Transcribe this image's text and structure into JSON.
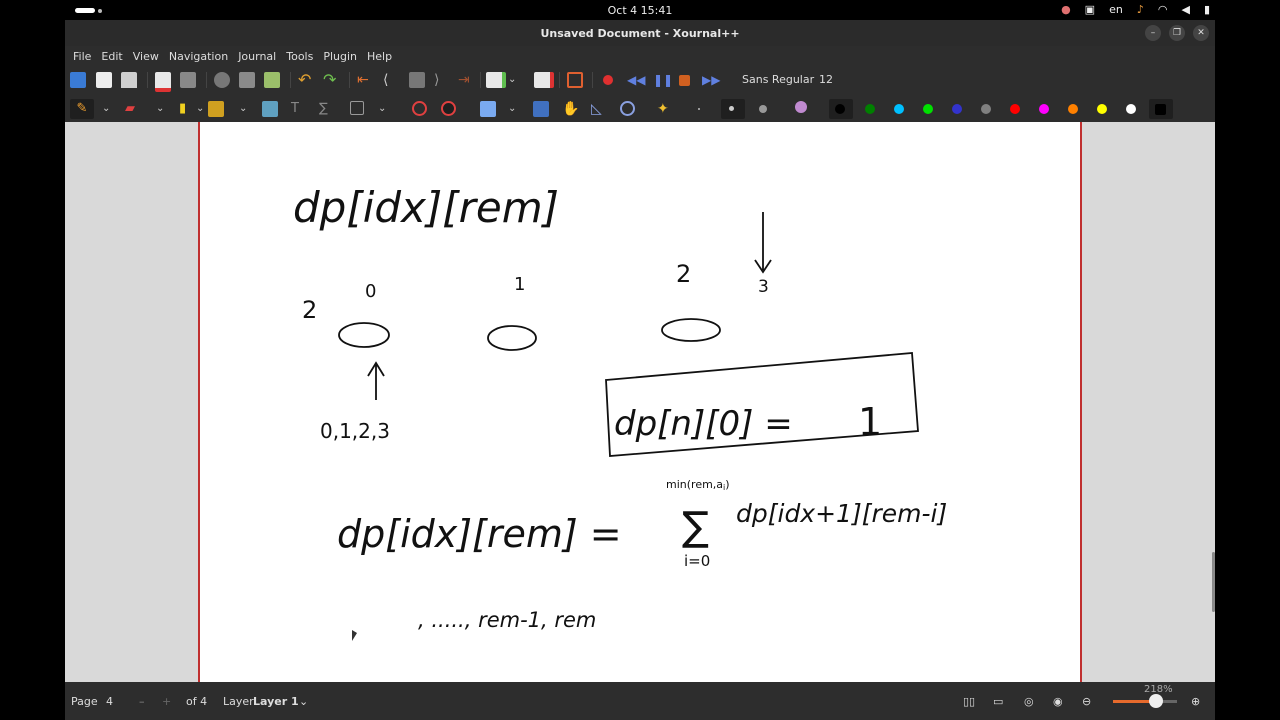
{
  "topbar": {
    "datetime": "Oct 4  15:41",
    "lang": "en"
  },
  "window": {
    "title": "Unsaved Document - Xournal++"
  },
  "menu": [
    "File",
    "Edit",
    "View",
    "Navigation",
    "Journal",
    "Tools",
    "Plugin",
    "Help"
  ],
  "toolbar": {
    "font_name": "Sans Regular",
    "font_size": "12"
  },
  "palette": [
    "#000000",
    "#008000",
    "#00c0ff",
    "#00e000",
    "#3333cc",
    "#808080",
    "#ff0000",
    "#ff00ff",
    "#ff8000",
    "#ffff00",
    "#ffffff",
    "#000000"
  ],
  "status": {
    "page_label": "Page",
    "page_value": "4",
    "page_of": "of 4",
    "layer_label": "Layer",
    "layer_value": "Layer 1",
    "zoom": "218%",
    "zoom_level": 0.67
  },
  "notes": {
    "line1": "dp[idx][rem]",
    "two_left": "2",
    "zero": "0",
    "one": "1",
    "two": "2",
    "three": "3",
    "range": "0,1,2,3",
    "base_case": "dp[n][0] =",
    "base_value": "1",
    "recurrence_lhs": "dp[idx][rem] =",
    "sum_upper": "min(rem,a",
    "sum_upper_sub": "i",
    "sum_upper_end": ")",
    "sum_lower": "i=0",
    "sum_term": "dp[idx+1][rem-i]",
    "bottom_line": ", .....,  rem-1,  rem"
  }
}
